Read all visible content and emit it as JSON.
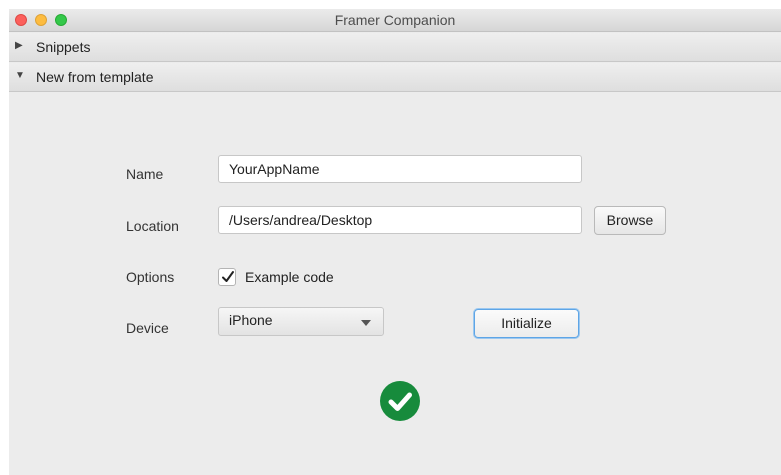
{
  "window": {
    "title": "Framer Companion"
  },
  "sections": {
    "snippets": {
      "label": "Snippets",
      "expanded": false
    },
    "new_from_template": {
      "label": "New from template",
      "expanded": true
    }
  },
  "form": {
    "name_label": "Name",
    "name_value": "YourAppName",
    "location_label": "Location",
    "location_value": "/Users/andrea/Desktop",
    "browse_label": "Browse",
    "options_label": "Options",
    "example_code_label": "Example code",
    "example_code_checked": true,
    "device_label": "Device",
    "device_selected": "iPhone",
    "initialize_label": "Initialize"
  },
  "status": {
    "icon": "checkmark-circle-icon",
    "color": "#178b3c"
  },
  "colors": {
    "close": "#fc605c",
    "minimize": "#fdbc40",
    "maximize": "#34c84a",
    "focus_ring": "#5ea5e6"
  }
}
